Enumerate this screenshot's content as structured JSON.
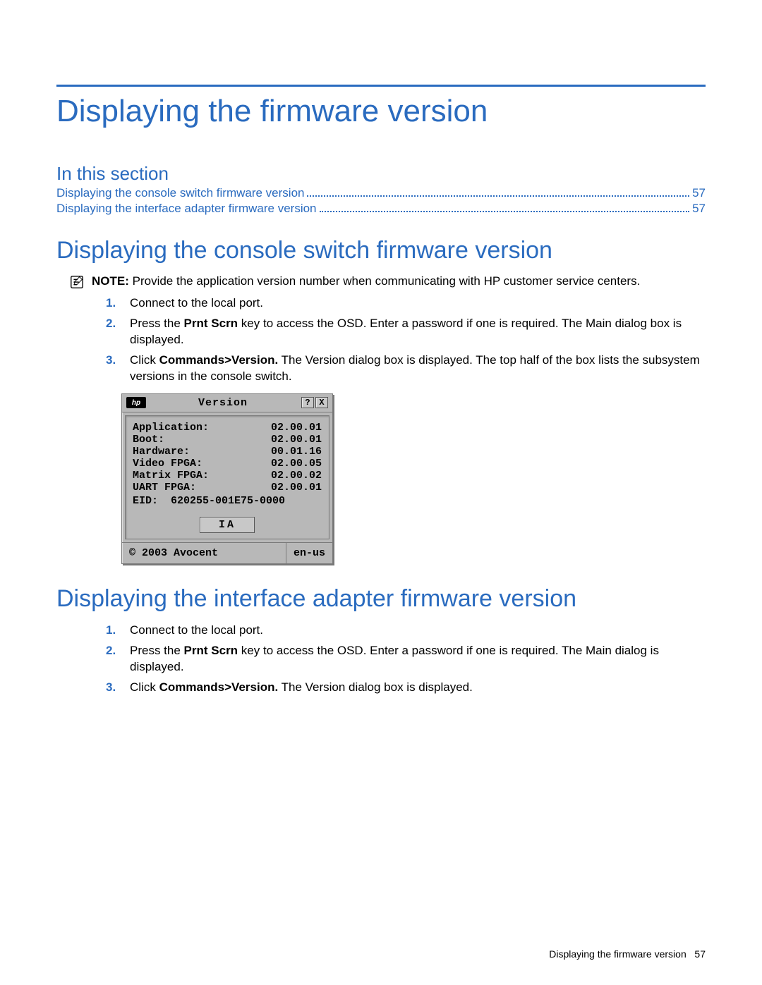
{
  "title": "Displaying the firmware version",
  "in_this_section": "In this section",
  "toc": [
    {
      "label": "Displaying the console switch firmware version",
      "page": "57"
    },
    {
      "label": "Displaying the interface adapter firmware version",
      "page": "57"
    }
  ],
  "section1": {
    "heading": "Displaying the console switch firmware version",
    "note_label": "NOTE:",
    "note_text": "Provide the application version number when communicating with HP customer service centers.",
    "steps": [
      {
        "n": "1.",
        "text": "Connect to the local port."
      },
      {
        "n": "2.",
        "pre": "Press the ",
        "bold": "Prnt Scrn",
        "post": " key to access the OSD. Enter a password if one is required. The Main dialog box is displayed."
      },
      {
        "n": "3.",
        "pre": "Click ",
        "bold": "Commands>Version.",
        "post": " The Version dialog box is displayed. The top half of the box lists the subsystem versions in the console switch."
      }
    ]
  },
  "dialog": {
    "title": "Version",
    "help": "?",
    "close": "X",
    "rows": [
      {
        "k": "Application:",
        "v": "02.00.01"
      },
      {
        "k": "Boot:",
        "v": "02.00.01"
      },
      {
        "k": "Hardware:",
        "v": "00.01.16"
      },
      {
        "k": "Video FPGA:",
        "v": "02.00.05"
      },
      {
        "k": "Matrix FPGA:",
        "v": "02.00.02"
      },
      {
        "k": "UART FPGA:",
        "v": "02.00.01"
      }
    ],
    "eid_label": "EID:",
    "eid_value": "620255-001E75-0000",
    "ia_button": "IA",
    "copyright": "© 2003 Avocent",
    "lang": "en-us",
    "logo": "hp"
  },
  "section2": {
    "heading": "Displaying the interface adapter firmware version",
    "steps": [
      {
        "n": "1.",
        "text": "Connect to the local port."
      },
      {
        "n": "2.",
        "pre": "Press the ",
        "bold": "Prnt Scrn",
        "post": " key to access the OSD. Enter a password if one is required. The Main dialog is displayed."
      },
      {
        "n": "3.",
        "pre": "Click ",
        "bold": "Commands>Version.",
        "post": " The Version dialog box is displayed."
      }
    ]
  },
  "footer": {
    "label": "Displaying the firmware version",
    "page": "57"
  }
}
